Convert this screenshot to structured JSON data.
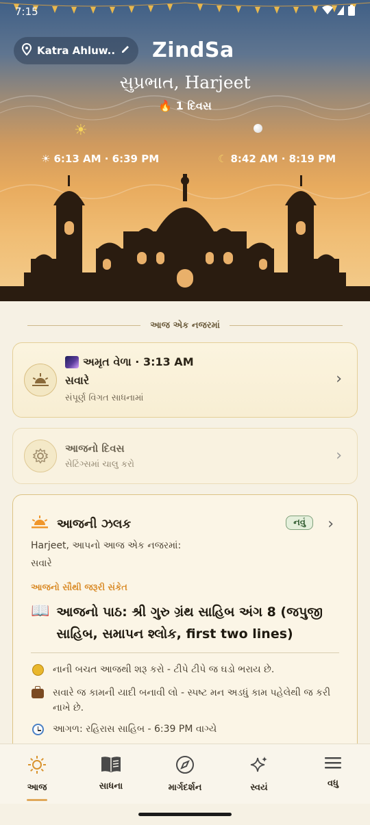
{
  "status_bar": {
    "time": "7:15"
  },
  "header": {
    "location": "Katra Ahluw...",
    "brand": "ZindSa",
    "greeting": "સુપ્રભાત, Harjeet",
    "streak": "1 દિવસ",
    "sun_times": "6:13 AM · 6:39 PM",
    "moon_times": "8:42 AM · 8:19 PM"
  },
  "section_title": "આજ એક નજરમાં",
  "card_amrit": {
    "title": "અમૃત વેળા · 3:13 AM",
    "subtitle": "સવારે",
    "detail": "સંપૂર્ણ વિગત સાધનામાં"
  },
  "card_day": {
    "title": "આજનો દિવસ",
    "detail": "સેટિંગ્સમાં ચાલુ કરો"
  },
  "card_glimpse": {
    "title": "આજની ઝલક",
    "badge": "નવું",
    "intro": "Harjeet, આપનો આજ એક નજરમાં:",
    "time_of_day": "સવારે",
    "important_label": "આજનો સૌથી જરૂરી સંકેત",
    "main_text": "આજનો પાઠ: શ્રી ગુરુ ગ્રંથ સાહિબ અંગ 8 (જપુજી સાહિબ, સમાપન શ્લોક, first two lines)",
    "tips": [
      {
        "icon": "coin-icon",
        "text": "નાની બચત આજથી શરૂ કરો - ટીપે ટીપે જ ઘડો ભરાય છે."
      },
      {
        "icon": "briefcase-icon",
        "text": "સવારે જ કામની યાદી બનાવી લો - સ્પષ્ટ મન અડધું કામ પહેલેથી જ કરી નાખે છે."
      },
      {
        "icon": "clock-icon",
        "text": "આગળ: રહિરાસ સાહિબ - 6:39 PM વાગ્યે"
      }
    ]
  },
  "nav": [
    {
      "label": "આજ",
      "icon": "sun-icon"
    },
    {
      "label": "સાધના",
      "icon": "book-icon"
    },
    {
      "label": "માર્ગદર્શન",
      "icon": "compass-icon"
    },
    {
      "label": "સ્વયં",
      "icon": "sparkles-icon"
    },
    {
      "label": "વધુ",
      "icon": "menu-icon"
    }
  ],
  "colors": {
    "accent": "#e0a85a",
    "badge_green": "#7ea07a",
    "label_orange": "#d98a26"
  }
}
